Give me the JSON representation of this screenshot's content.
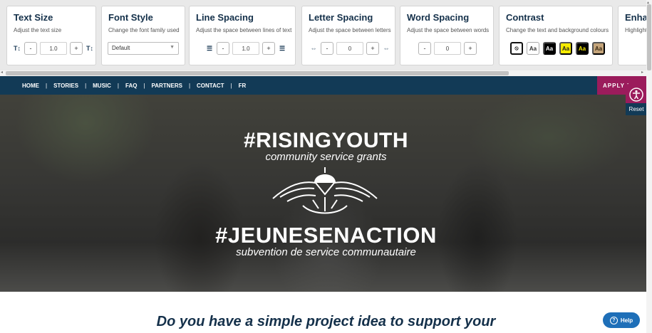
{
  "toolbar": {
    "text_size": {
      "title": "Text Size",
      "desc": "Adjust the text size",
      "value": "1.0",
      "minus": "-",
      "plus": "+",
      "icon_left": "T↕",
      "icon_right": "T↕"
    },
    "font_style": {
      "title": "Font Style",
      "desc": "Change the font family used",
      "selected": "Default"
    },
    "line_spacing": {
      "title": "Line Spacing",
      "desc": "Adjust the space between lines of text",
      "value": "1.0",
      "minus": "-",
      "plus": "+"
    },
    "letter_spacing": {
      "title": "Letter Spacing",
      "desc": "Adjust the space between letters",
      "value": "0",
      "minus": "-",
      "plus": "+"
    },
    "word_spacing": {
      "title": "Word Spacing",
      "desc": "Adjust the space between words",
      "value": "0",
      "minus": "-",
      "plus": "+"
    },
    "contrast": {
      "title": "Contrast",
      "desc": "Change the text and background colours",
      "swatch_label": "Aa"
    },
    "enhance": {
      "title": "Enhan",
      "desc": "Highlight"
    }
  },
  "nav": {
    "items": [
      "HOME",
      "STORIES",
      "MUSIC",
      "FAQ",
      "PARTNERS",
      "CONTACT",
      "FR"
    ],
    "separator": "|",
    "apply": "APPLY I"
  },
  "hero": {
    "title_en": "#RISINGYOUTH",
    "subtitle_en": "community service grants",
    "title_fr": "#JEUNESENACTION",
    "subtitle_fr": "subvention de service communautaire"
  },
  "main": {
    "heading": "Do you have a simple project idea to support your"
  },
  "widget": {
    "reset": "Reset",
    "help": "Help"
  },
  "colors": {
    "navy": "#123a56",
    "magenta": "#9b1c5c",
    "help_blue": "#1e6fb8"
  }
}
